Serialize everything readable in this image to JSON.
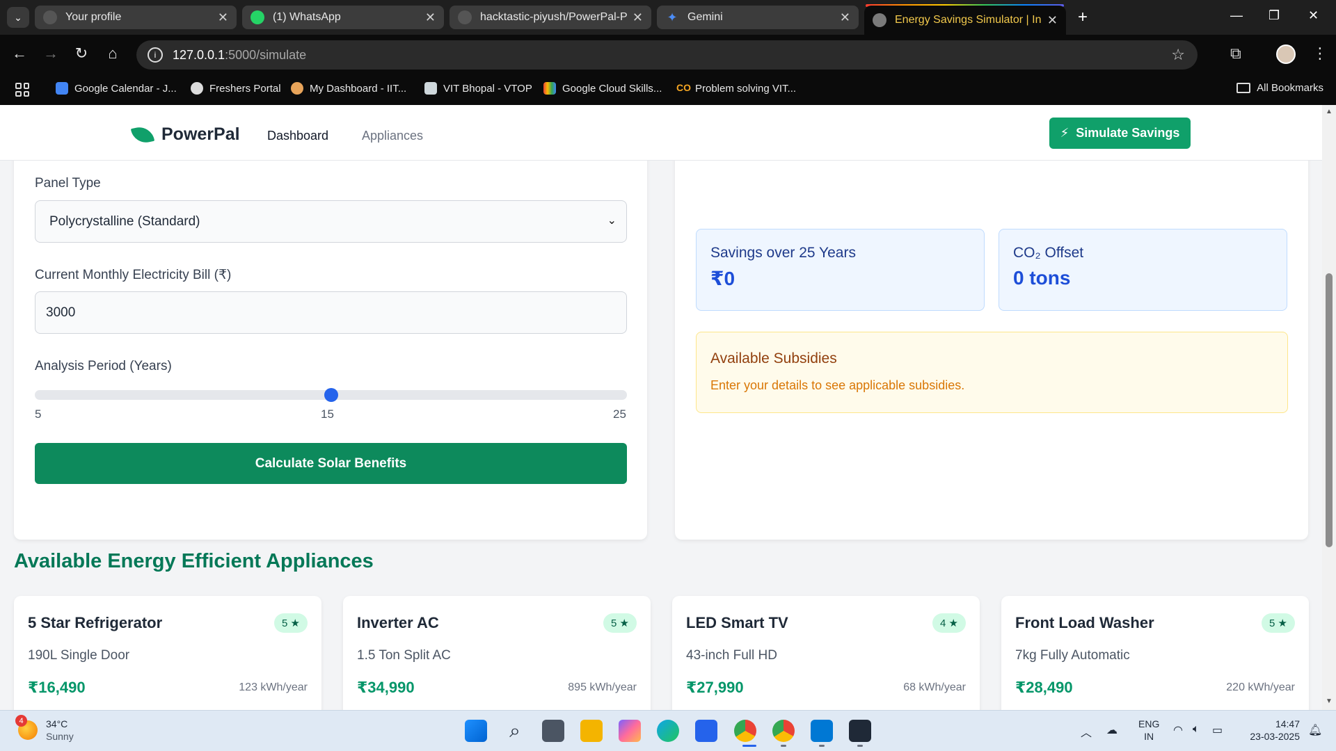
{
  "browser": {
    "tabs": [
      {
        "title": "Your profile",
        "favicon_color": "#555555"
      },
      {
        "title": "(1) WhatsApp",
        "favicon_color": "#25d366"
      },
      {
        "title": "hacktastic-piyush/PowerPal-Pro",
        "favicon_color": "#555555"
      },
      {
        "title": "Gemini",
        "favicon_color": "#4c8df6"
      },
      {
        "title": "Energy Savings Simulator | India",
        "favicon_color": "#7a7a7a"
      }
    ],
    "url_host": "127.0.0.1",
    "url_path": ":5000/simulate",
    "bookmarks": [
      "Google Calendar - J...",
      "Freshers Portal",
      "My Dashboard - IIT...",
      "VIT Bhopal - VTOP",
      "Google Cloud Skills...",
      "Problem solving VIT..."
    ],
    "all_bookmarks": "All Bookmarks"
  },
  "app": {
    "brand": "PowerPal",
    "nav": [
      "Dashboard",
      "Appliances"
    ],
    "simulate_button": "Simulate Savings",
    "brand_color": "#10a06a"
  },
  "form": {
    "panel_type_label": "Panel Type",
    "panel_type_value": "Polycrystalline (Standard)",
    "bill_label": "Current Monthly Electricity Bill (₹)",
    "bill_value": "3000",
    "period_label": "Analysis Period (Years)",
    "period_min": "5",
    "period_value": "15",
    "period_max": "25",
    "period_slider_fraction": 0.5,
    "calculate_button": "Calculate Solar Benefits"
  },
  "results": {
    "savings_label": "Savings over 25 Years",
    "savings_value": "₹0",
    "co2_label": "CO₂ Offset",
    "co2_value": "0 tons",
    "subsidies_title": "Available Subsidies",
    "subsidies_text": "Enter your details to see applicable subsidies."
  },
  "appliances_section": {
    "title": "Available Energy Efficient Appliances",
    "items": [
      {
        "name": "5 Star Refrigerator",
        "rating": "5 ★",
        "desc": "190L Single Door",
        "price": "₹16,490",
        "energy": "123 kWh/year"
      },
      {
        "name": "Inverter AC",
        "rating": "5 ★",
        "desc": "1.5 Ton Split AC",
        "price": "₹34,990",
        "energy": "895 kWh/year"
      },
      {
        "name": "LED Smart TV",
        "rating": "4 ★",
        "desc": "43-inch Full HD",
        "price": "₹27,990",
        "energy": "68 kWh/year"
      },
      {
        "name": "Front Load Washer",
        "rating": "5 ★",
        "desc": "7kg Fully Automatic",
        "price": "₹28,490",
        "energy": "220 kWh/year"
      }
    ]
  },
  "taskbar": {
    "temp": "34°C",
    "condition": "Sunny",
    "weather_badge": "4",
    "lang_top": "ENG",
    "lang_bottom": "IN",
    "time": "14:47",
    "date": "23-03-2025"
  }
}
